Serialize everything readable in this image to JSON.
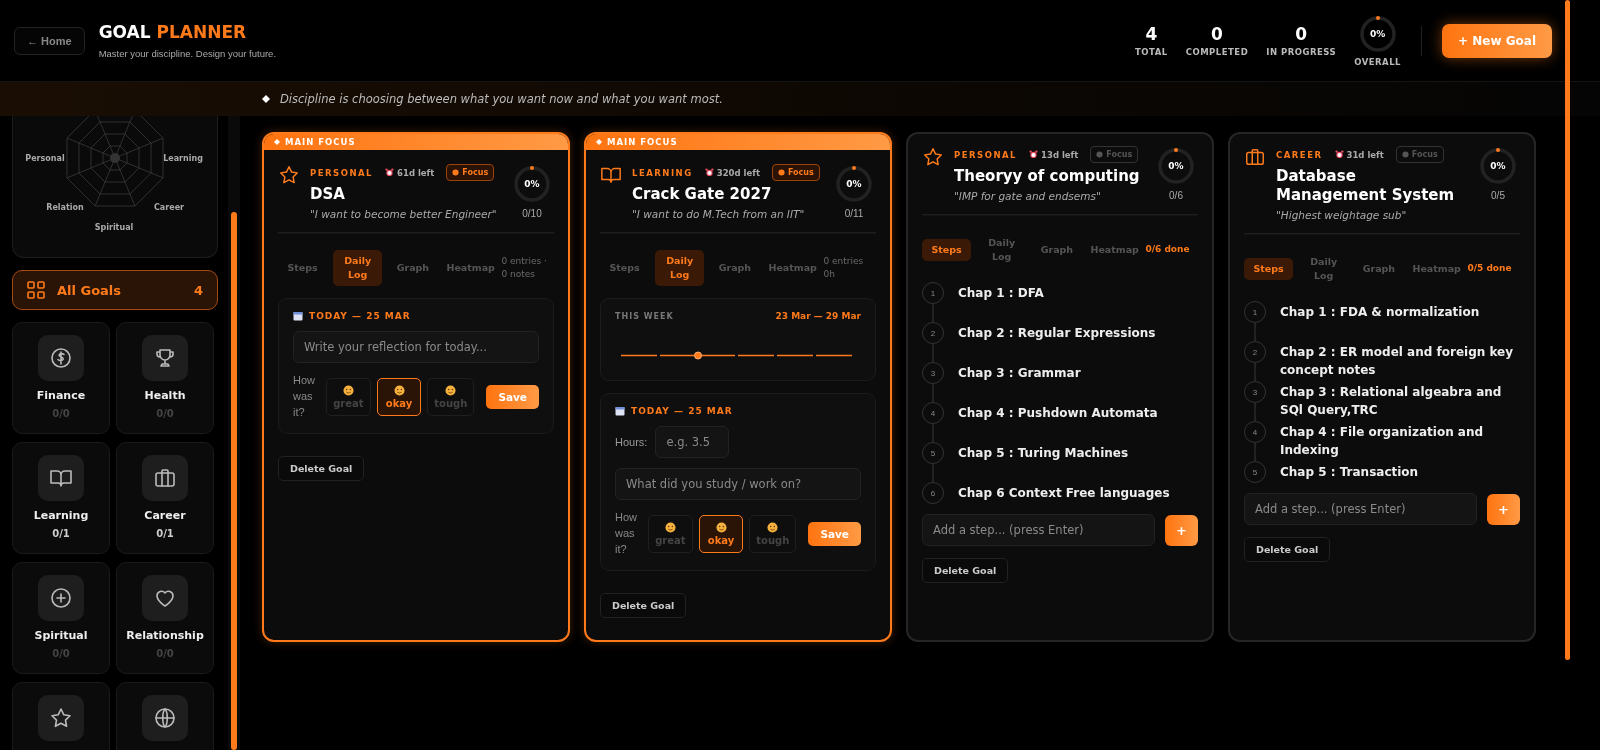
{
  "header": {
    "home_button": "← Home",
    "title_main": "GOAL",
    "title_accent": "PLANNER",
    "subtitle": "Master your discipline. Design your future.",
    "stats": [
      {
        "value": "4",
        "label": "TOTAL"
      },
      {
        "value": "0",
        "label": "COMPLETED"
      },
      {
        "value": "0",
        "label": "IN PROGRESS"
      }
    ],
    "overall": {
      "reading": "0%",
      "label": "OVERALL",
      "level": 0
    },
    "new_goal_button": "+ New Goal"
  },
  "quote": "Discipline is choosing between what you want now and what you want most.",
  "sidebar": {
    "radar_labels": [
      "Personal",
      "Learning",
      "Career",
      "Spiritual",
      "Relation"
    ],
    "all_goals": {
      "label": "All Goals",
      "count": "4",
      "selected": true
    },
    "categories": [
      {
        "kind": "finance",
        "label": "Finance",
        "count": "0/0",
        "empty": true
      },
      {
        "kind": "health",
        "label": "Health",
        "count": "0/0",
        "empty": true
      },
      {
        "kind": "learning",
        "label": "Learning",
        "count": "0/1",
        "empty": false
      },
      {
        "kind": "career",
        "label": "Career",
        "count": "0/1",
        "empty": false
      },
      {
        "kind": "spiritual",
        "label": "Spiritual",
        "count": "0/0",
        "empty": true
      },
      {
        "kind": "relationship",
        "label": "Relationship",
        "count": "0/0",
        "empty": true
      },
      {
        "kind": "personal"
      },
      {
        "kind": "other"
      }
    ]
  },
  "goals": [
    {
      "main_focus": true,
      "banner": "MAIN FOCUS",
      "kind": "personal",
      "category": "PERSONAL",
      "days_left": "61d left",
      "focus_badge": "Focus",
      "title": "DSA",
      "quote": "\"I want to become better Engineer\"",
      "progress": {
        "reading": "0%",
        "count": "0/10",
        "level": 0
      },
      "tabs": [
        {
          "label": "Steps",
          "selected": false
        },
        {
          "label": "Daily Log",
          "selected": true
        },
        {
          "label": "Graph",
          "selected": false
        },
        {
          "label": "Heatmap",
          "selected": false
        }
      ],
      "tab_note": {
        "text": "0 entries · 0 notes",
        "accent": false
      },
      "panel": {
        "kind": "daily_log",
        "log": {
          "date": "TODAY — 25 MAR",
          "reflection_placeholder": "Write your reflection for today...",
          "mood_prompt": "How was it?",
          "moods": [
            {
              "label": "great",
              "selected": false
            },
            {
              "label": "okay",
              "selected": true
            },
            {
              "label": "tough",
              "selected": false
            }
          ],
          "save": "Save"
        }
      },
      "delete": "Delete Goal"
    },
    {
      "main_focus": true,
      "banner": "MAIN FOCUS",
      "kind": "learning",
      "category": "LEARNING",
      "days_left": "320d left",
      "focus_badge": "Focus",
      "title": "Crack Gate 2027",
      "quote": "\"I want to do M.Tech from an IIT\"",
      "progress": {
        "reading": "0%",
        "count": "0/11",
        "level": 0
      },
      "tabs": [
        {
          "label": "Steps",
          "selected": false
        },
        {
          "label": "Daily Log",
          "selected": true
        },
        {
          "label": "Graph",
          "selected": false
        },
        {
          "label": "Heatmap",
          "selected": false
        }
      ],
      "tab_note": {
        "text": "0 entries 0h",
        "accent": false
      },
      "panel": {
        "kind": "daily_log",
        "week": {
          "title": "THIS WEEK",
          "range": "23 Mar — 29 Mar"
        },
        "log": {
          "date": "TODAY — 25 MAR",
          "hours_label": "Hours:",
          "hours_placeholder": "e.g. 3.5",
          "reflection_placeholder": "What did you study / work on?",
          "mood_prompt": "How was it?",
          "moods": [
            {
              "label": "great",
              "selected": false
            },
            {
              "label": "okay",
              "selected": true
            },
            {
              "label": "tough",
              "selected": false
            }
          ],
          "save": "Save"
        }
      },
      "delete": "Delete Goal"
    },
    {
      "main_focus": false,
      "kind": "personal",
      "category": "PERSONAL",
      "days_left": "13d left",
      "focus_badge": "Focus",
      "title": "Theoryy of computing",
      "quote": "\"IMP for gate and endsems\"",
      "progress": {
        "reading": "0%",
        "count": "0/6",
        "level": 0
      },
      "tabs": [
        {
          "label": "Steps",
          "selected": true
        },
        {
          "label": "Daily Log",
          "selected": false
        },
        {
          "label": "Graph",
          "selected": false
        },
        {
          "label": "Heatmap",
          "selected": false
        }
      ],
      "tab_note": {
        "text": "0/6 done",
        "accent": true
      },
      "panel": {
        "kind": "steps",
        "steps": [
          {
            "number": "1",
            "text": "Chap 1 : DFA"
          },
          {
            "number": "2",
            "text": "Chap 2 : Regular Expressions"
          },
          {
            "number": "3",
            "text": "Chap 3 : Grammar"
          },
          {
            "number": "4",
            "text": "Chap 4 : Pushdown Automata"
          },
          {
            "number": "5",
            "text": "Chap 5 : Turing Machines"
          },
          {
            "number": "6",
            "text": "Chap 6 Context Free languages"
          }
        ],
        "add_placeholder": "Add a step... (press Enter)",
        "add_button": "+"
      },
      "delete": "Delete Goal"
    },
    {
      "main_focus": false,
      "kind": "career",
      "category": "CAREER",
      "days_left": "31d left",
      "focus_badge": "Focus",
      "title": "Database Management System",
      "quote": "\"Highest weightage sub\"",
      "progress": {
        "reading": "0%",
        "count": "0/5",
        "level": 0
      },
      "tabs": [
        {
          "label": "Steps",
          "selected": true
        },
        {
          "label": "Daily Log",
          "selected": false
        },
        {
          "label": "Graph",
          "selected": false
        },
        {
          "label": "Heatmap",
          "selected": false
        }
      ],
      "tab_note": {
        "text": "0/5 done",
        "accent": true
      },
      "panel": {
        "kind": "steps",
        "steps": [
          {
            "number": "1",
            "text": "Chap 1 : FDA & normalization"
          },
          {
            "number": "2",
            "text": "Chap 2 : ER model and foreign key concept notes"
          },
          {
            "number": "3",
            "text": "Chap 3 : Relational algeabra and SQl Query,TRC"
          },
          {
            "number": "4",
            "text": "Chap 4 : File organization and Indexing"
          },
          {
            "number": "5",
            "text": "Chap 5 : Transaction"
          }
        ],
        "add_placeholder": "Add a step... (press Enter)",
        "add_button": "+"
      },
      "delete": "Delete Goal"
    }
  ]
}
